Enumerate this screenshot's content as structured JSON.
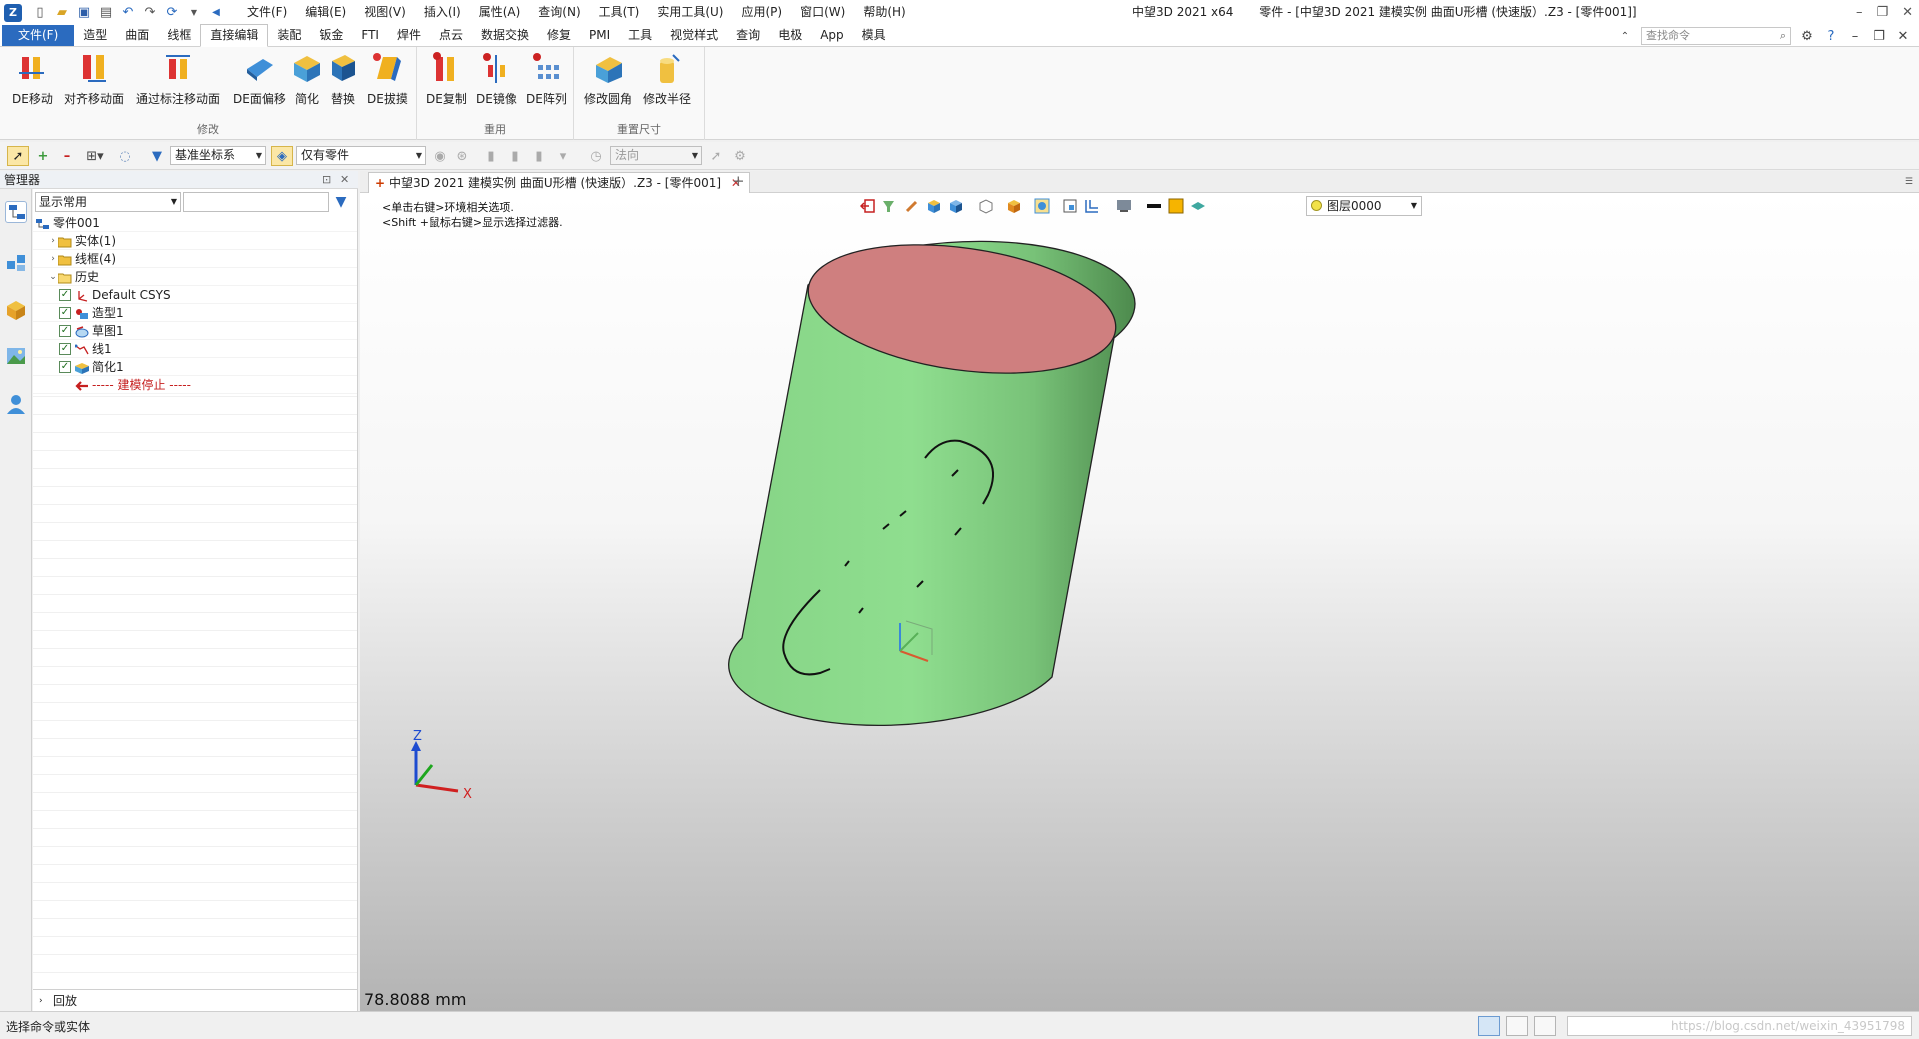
{
  "titlebar": {
    "menu": [
      "文件(F)",
      "编辑(E)",
      "视图(V)",
      "插入(I)",
      "属性(A)",
      "查询(N)",
      "工具(T)",
      "实用工具(U)",
      "应用(P)",
      "窗口(W)",
      "帮助(H)"
    ],
    "app_name": "中望3D 2021 x64",
    "doc_title": "零件 - [中望3D 2021 建模实例 曲面U形槽 (快速版）.Z3 - [零件001]]"
  },
  "ribbon": {
    "tabs": [
      "文件(F)",
      "造型",
      "曲面",
      "线框",
      "直接编辑",
      "装配",
      "钣金",
      "FTI",
      "焊件",
      "点云",
      "数据交换",
      "修复",
      "PMI",
      "工具",
      "视觉样式",
      "查询",
      "电极",
      "App",
      "模具"
    ],
    "active_tab": "直接编辑",
    "search_placeholder": "查找命令",
    "groups": [
      {
        "label": "修改",
        "buttons": [
          "DE移动",
          "对齐移动面",
          "通过标注移动面",
          "DE面偏移",
          "简化",
          "替换",
          "DE拔摸"
        ]
      },
      {
        "label": "重用",
        "buttons": [
          "DE复制",
          "DE镜像",
          "DE阵列"
        ]
      },
      {
        "label": "重置尺寸",
        "buttons": [
          "修改圆角",
          "修改半径"
        ]
      }
    ]
  },
  "toolbar": {
    "csys": "基准坐标系",
    "filter": "仅有零件",
    "direction": "法向"
  },
  "manager": {
    "title": "管理器",
    "display_filter": "显示常用",
    "tree": [
      {
        "label": "零件001",
        "level": 0,
        "icon": "part-icon",
        "expand": ""
      },
      {
        "label": "实体(1)",
        "level": 1,
        "icon": "folder-icon",
        "expand": "›"
      },
      {
        "label": "线框(4)",
        "level": 1,
        "icon": "folder-icon",
        "expand": "›"
      },
      {
        "label": "历史",
        "level": 1,
        "icon": "folder-open-icon",
        "expand": "⌄"
      },
      {
        "label": "Default CSYS",
        "level": 2,
        "icon": "csys-icon",
        "checked": true
      },
      {
        "label": "造型1",
        "level": 2,
        "icon": "shape-icon",
        "checked": true
      },
      {
        "label": "草图1",
        "level": 2,
        "icon": "sketch-icon",
        "checked": true
      },
      {
        "label": "线1",
        "level": 2,
        "icon": "line-icon",
        "checked": true
      },
      {
        "label": "简化1",
        "level": 2,
        "icon": "simplify-icon",
        "checked": true
      },
      {
        "label": "----- 建模停止 -----",
        "level": 2,
        "icon": "stop-arrow-icon",
        "stop": true
      }
    ],
    "rollback": "回放"
  },
  "document": {
    "tab_label": "中望3D 2021 建模实例 曲面U形槽 (快速版）.Z3 - [零件001]"
  },
  "viewport": {
    "hint1": "<单击右键>环境相关选项.",
    "hint2": "<Shift +鼠标右键>显示选择过滤器.",
    "layer": "图层0000",
    "measure": "78.8088 mm",
    "axis_x": "X",
    "axis_z": "Z"
  },
  "status": {
    "text": "选择命令或实体",
    "watermark": "https://blog.csdn.net/weixin_43951798"
  },
  "colors": {
    "cylinder_side": "#8cd88c",
    "cylinder_top": "#cf7f7f",
    "accent": "#2b6bbf"
  }
}
